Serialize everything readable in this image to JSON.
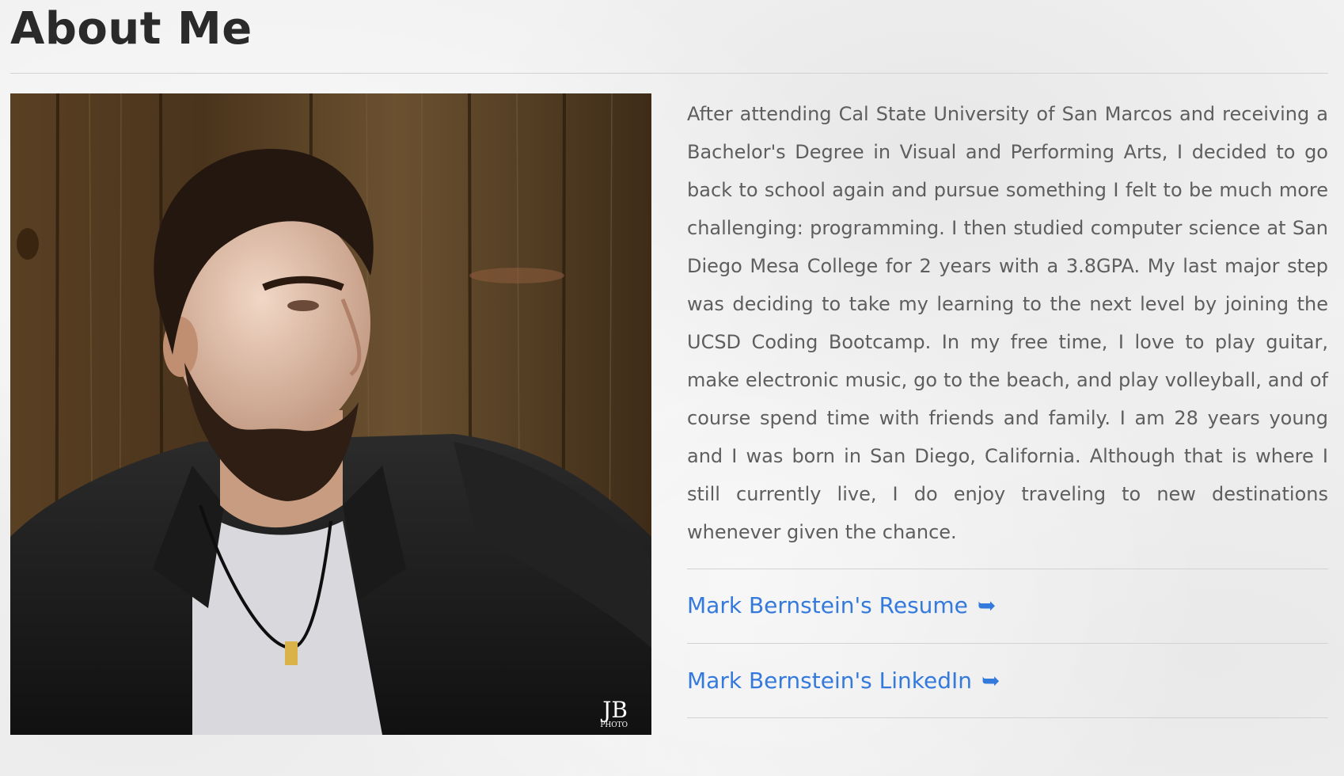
{
  "page": {
    "title": "About Me"
  },
  "portrait": {
    "watermark_main": "JB",
    "watermark_sub": "PHOTO"
  },
  "bio": {
    "text": "After attending Cal State University of San Marcos and receiving a Bachelor's Degree in Visual and Performing Arts, I decided to go back to school again and pursue something I felt to be much more challenging: programming. I then studied computer science at San Diego Mesa College for 2 years with a 3.8GPA. My last major step was deciding to take my learning to the next level by joining the UCSD Coding Bootcamp. In my free time, I love to play guitar, make electronic music, go to the beach, and play volleyball, and of course spend time with friends and family. I am 28 years young and I was born in San Diego, California. Although that is where I still currently live, I do enjoy traveling to new destinations whenever given the chance."
  },
  "links": {
    "resume_label": "Mark Bernstein's Resume",
    "linkedin_label": "Mark Bernstein's LinkedIn",
    "arrow_glyph": "➥",
    "color": "#3479dc"
  }
}
